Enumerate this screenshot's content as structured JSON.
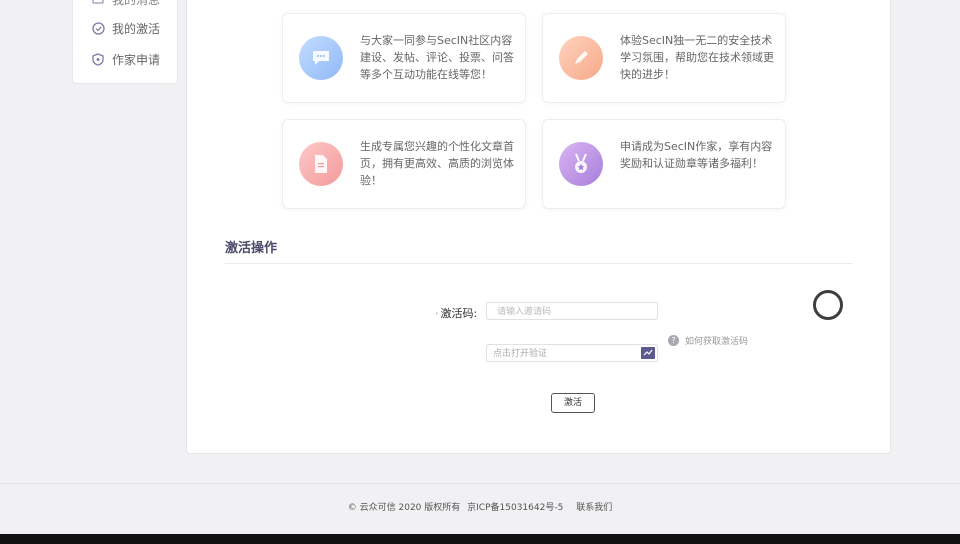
{
  "sidebar": {
    "items": [
      {
        "label": "我的消息",
        "icon": "message-icon"
      },
      {
        "label": "我的激活",
        "icon": "check-circle-icon"
      },
      {
        "label": "作家申请",
        "icon": "shield-icon"
      }
    ]
  },
  "cards": [
    {
      "text": "与大家一同参与SecIN社区内容建设、发帖、评论、投票、问答等多个互动功能在线等您！",
      "icon": "chat-bubble-icon",
      "color": "#a8c8fa"
    },
    {
      "text": "体验SecIN独一无二的安全技术学习氛围，帮助您在技术领域更快的进步！",
      "icon": "pencil-icon",
      "color": "#f9b89c"
    },
    {
      "text": "生成专属您兴趣的个性化文章首页，拥有更高效、高质的浏览体验！",
      "icon": "document-icon",
      "color": "#f5abab"
    },
    {
      "text": "申请成为SecIN作家，享有内容奖励和认证勋章等诸多福利！",
      "icon": "medal-icon",
      "color": "#b98de3"
    }
  ],
  "activation": {
    "section_title": "激活操作",
    "code_label": "激活码:",
    "code_placeholder": "请输入邀请码",
    "help_text": "如何获取激活码",
    "verify_text": "点击打开验证",
    "submit_label": "激活"
  },
  "footer": {
    "copyright": "© 云众可信 2020 版权所有",
    "icp": "京ICP备15031642号-5",
    "contact": "联系我们"
  }
}
